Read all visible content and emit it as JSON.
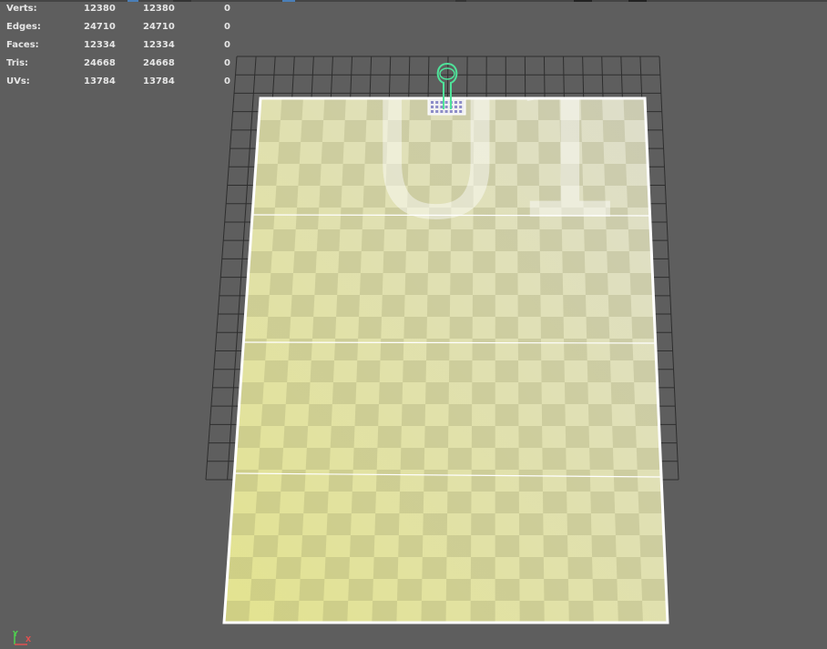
{
  "stats": [
    {
      "label": "Verts:",
      "a": "12380",
      "b": "12380",
      "c": "0"
    },
    {
      "label": "Edges:",
      "a": "24710",
      "b": "24710",
      "c": "0"
    },
    {
      "label": "Faces:",
      "a": "12334",
      "b": "12334",
      "c": "0"
    },
    {
      "label": "Tris:",
      "a": "24668",
      "b": "24668",
      "c": "0"
    },
    {
      "label": "UVs:",
      "a": "13784",
      "b": "13784",
      "c": "0"
    }
  ],
  "viewport": {
    "tile_label": "U1",
    "background_color": "#5e5e5e",
    "grid_color": "#2e2e2e",
    "plane_color_light": "#e6e6a4",
    "plane_color_dark": "#c9c98a",
    "selection_color": "#ffffff",
    "manipulator_color": "#4fe39a"
  },
  "axis": {
    "y": "Y",
    "x": "X"
  }
}
